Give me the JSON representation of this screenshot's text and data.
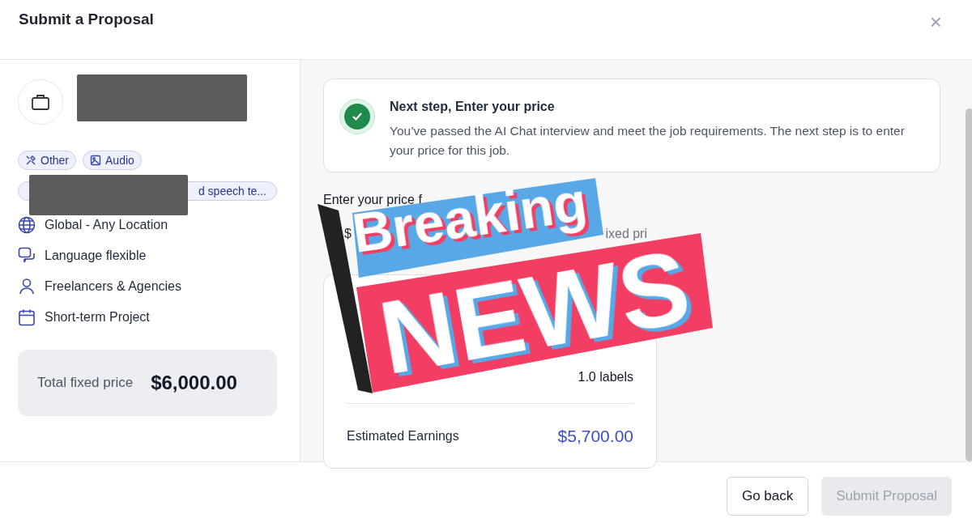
{
  "dialog": {
    "title": "Submit a Proposal",
    "close": "×"
  },
  "job": {
    "tags": [
      {
        "kind": "tools",
        "label": "Other"
      },
      {
        "kind": "image",
        "label": "Audio"
      },
      {
        "kind": "redacted",
        "label": "d speech te..."
      }
    ],
    "details": [
      {
        "kind": "globe",
        "text": "Global - Any Location"
      },
      {
        "kind": "chat",
        "text": "Language flexible"
      },
      {
        "kind": "person",
        "text": "Freelancers & Agencies"
      },
      {
        "kind": "calendar",
        "text": "Short-term Project"
      }
    ],
    "total": {
      "label": "Total fixed price",
      "value": "$6,000.00"
    }
  },
  "notice": {
    "title": "Next step, Enter your price",
    "body": "You’ve passed the AI Chat interview and meet the job requirements. The next step is to enter your price for this job."
  },
  "price": {
    "prompt": "Enter your price f",
    "prefix": "$",
    "hint": "ixed pri"
  },
  "earnings": {
    "rows": [
      {
        "value": "1.0 labels"
      }
    ],
    "total_label": "Estimated Earnings",
    "total_value": "$5,700.00"
  },
  "sticker": {
    "line_1": "Breaking",
    "line_2": "NEWS"
  },
  "footer": {
    "buttons": [
      {
        "label": "Go back",
        "disabled": false
      },
      {
        "label": "Submit Proposal",
        "disabled": true
      }
    ]
  }
}
